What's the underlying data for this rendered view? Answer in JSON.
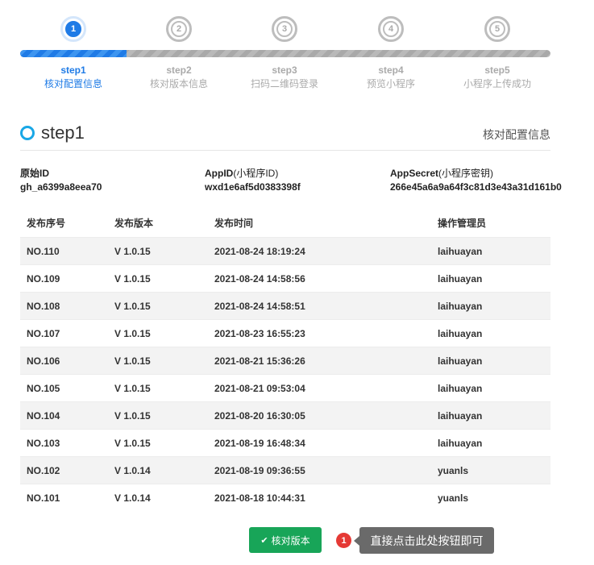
{
  "steps": [
    {
      "num": "1",
      "title": "step1",
      "sub": "核对配置信息",
      "active": true
    },
    {
      "num": "2",
      "title": "step2",
      "sub": "核对版本信息",
      "active": false
    },
    {
      "num": "3",
      "title": "step3",
      "sub": "扫码二维码登录",
      "active": false
    },
    {
      "num": "4",
      "title": "step4",
      "sub": "预览小程序",
      "active": false
    },
    {
      "num": "5",
      "title": "step5",
      "sub": "小程序上传成功",
      "active": false
    }
  ],
  "progress": 0.2,
  "section": {
    "title": "step1",
    "right": "核对配置信息"
  },
  "info": [
    {
      "label": "原始ID",
      "label_suffix": "",
      "value": "gh_a6399a8eea70"
    },
    {
      "label": "AppID",
      "label_suffix": "(小程序ID)",
      "value": "wxd1e6af5d0383398f"
    },
    {
      "label": "AppSecret",
      "label_suffix": "(小程序密钥)",
      "value": "266e45a6a9a64f3c81d3e43a31d161b0"
    }
  ],
  "table": {
    "headers": [
      "发布序号",
      "发布版本",
      "发布时间",
      "操作管理员"
    ],
    "rows": [
      [
        "NO.110",
        "V 1.0.15",
        "2021-08-24 18:19:24",
        "laihuayan"
      ],
      [
        "NO.109",
        "V 1.0.15",
        "2021-08-24 14:58:56",
        "laihuayan"
      ],
      [
        "NO.108",
        "V 1.0.15",
        "2021-08-24 14:58:51",
        "laihuayan"
      ],
      [
        "NO.107",
        "V 1.0.15",
        "2021-08-23 16:55:23",
        "laihuayan"
      ],
      [
        "NO.106",
        "V 1.0.15",
        "2021-08-21 15:36:26",
        "laihuayan"
      ],
      [
        "NO.105",
        "V 1.0.15",
        "2021-08-21 09:53:04",
        "laihuayan"
      ],
      [
        "NO.104",
        "V 1.0.15",
        "2021-08-20 16:30:05",
        "laihuayan"
      ],
      [
        "NO.103",
        "V 1.0.15",
        "2021-08-19 16:48:34",
        "laihuayan"
      ],
      [
        "NO.102",
        "V 1.0.14",
        "2021-08-19 09:36:55",
        "yuanls"
      ],
      [
        "NO.101",
        "V 1.0.14",
        "2021-08-18 10:44:31",
        "yuanls"
      ]
    ]
  },
  "button": {
    "label": "核对版本",
    "icon": "check-icon"
  },
  "tip": {
    "badge": "1",
    "text": "直接点击此处按钮即可"
  },
  "colors": {
    "accent": "#1f7be6",
    "button": "#18a558",
    "badge": "#e53935"
  }
}
